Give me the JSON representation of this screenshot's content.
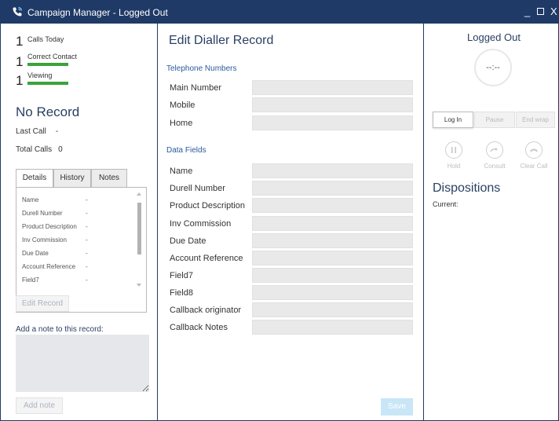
{
  "window": {
    "title": "Campaign Manager - Logged Out",
    "min_icon": "minimize-icon",
    "max_icon": "maximize-icon",
    "close_icon": "close-icon"
  },
  "stats": [
    {
      "num": "1",
      "label": "Calls Today"
    },
    {
      "num": "1",
      "label": "Correct Contact"
    },
    {
      "num": "1",
      "label": "Viewing"
    }
  ],
  "colors": {
    "titlebar": "#1f3a66",
    "accent_green": "#3aa33a",
    "heading_blue": "#2a3f63"
  },
  "record": {
    "heading": "No Record",
    "last_call_label": "Last Call",
    "last_call_value": "-",
    "total_calls_label": "Total Calls",
    "total_calls_value": "0"
  },
  "tabs": [
    "Details",
    "History",
    "Notes"
  ],
  "details": [
    {
      "label": "Name",
      "value": "-"
    },
    {
      "label": "Durell Number",
      "value": "-"
    },
    {
      "label": "Product Description",
      "value": "-"
    },
    {
      "label": "Inv Commission",
      "value": "-"
    },
    {
      "label": "Due Date",
      "value": "-"
    },
    {
      "label": "Account Reference",
      "value": "-"
    },
    {
      "label": "Field7",
      "value": "-"
    }
  ],
  "left_actions": {
    "edit_record": "Edit Record",
    "note_label": "Add a note to this record:",
    "note_value": "",
    "add_note": "Add note"
  },
  "editor": {
    "title": "Edit Dialler Record",
    "telephone_heading": "Telephone Numbers",
    "telephone_fields": [
      "Main Number",
      "Mobile",
      "Home"
    ],
    "data_heading": "Data Fields",
    "data_fields": [
      "Name",
      "Durell Number",
      "Product Description",
      "Inv Commission",
      "Due Date",
      "Account Reference",
      "Field7",
      "Field8",
      "Callback originator",
      "Callback Notes"
    ],
    "save": "Save"
  },
  "right": {
    "status": "Logged Out",
    "timer": "--:--",
    "buttons": [
      "Log In",
      "Pause",
      "End wrap"
    ],
    "call_controls": [
      "Hold",
      "Consult",
      "Clear Call"
    ],
    "dispositions": "Dispositions",
    "current_label": "Current:"
  }
}
